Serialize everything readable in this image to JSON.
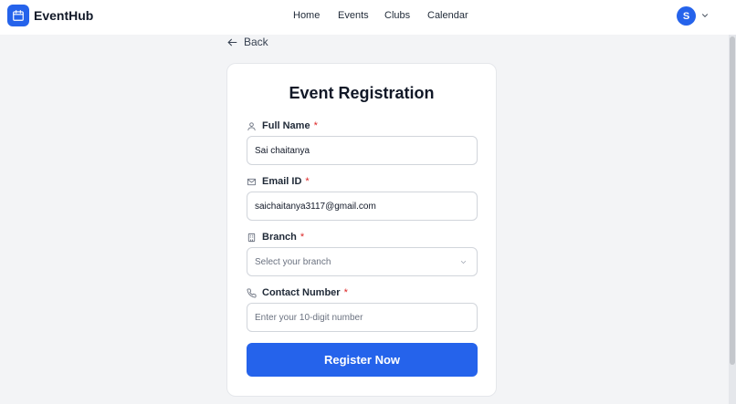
{
  "brand": {
    "name": "EventHub",
    "icon": "calendar-icon",
    "accent": "#2563eb"
  },
  "nav": {
    "items": [
      "Home",
      "Events",
      "Clubs",
      "Calendar"
    ]
  },
  "user": {
    "initial": "S"
  },
  "back": {
    "label": "Back"
  },
  "form": {
    "title": "Event Registration",
    "fields": [
      {
        "label": "Full Name",
        "required": "*",
        "icon": "user-icon",
        "value": "Sai chaitanya",
        "placeholder": ""
      },
      {
        "label": "Email ID",
        "required": "*",
        "icon": "mail-icon",
        "value": "saichaitanya3117@gmail.com",
        "placeholder": ""
      },
      {
        "label": "Branch",
        "required": "*",
        "icon": "building-icon",
        "value": "Select your branch",
        "placeholder": ""
      },
      {
        "label": "Contact Number",
        "required": "*",
        "icon": "phone-icon",
        "value": "",
        "placeholder": "Enter your 10-digit number"
      }
    ],
    "submit_label": "Register Now"
  }
}
